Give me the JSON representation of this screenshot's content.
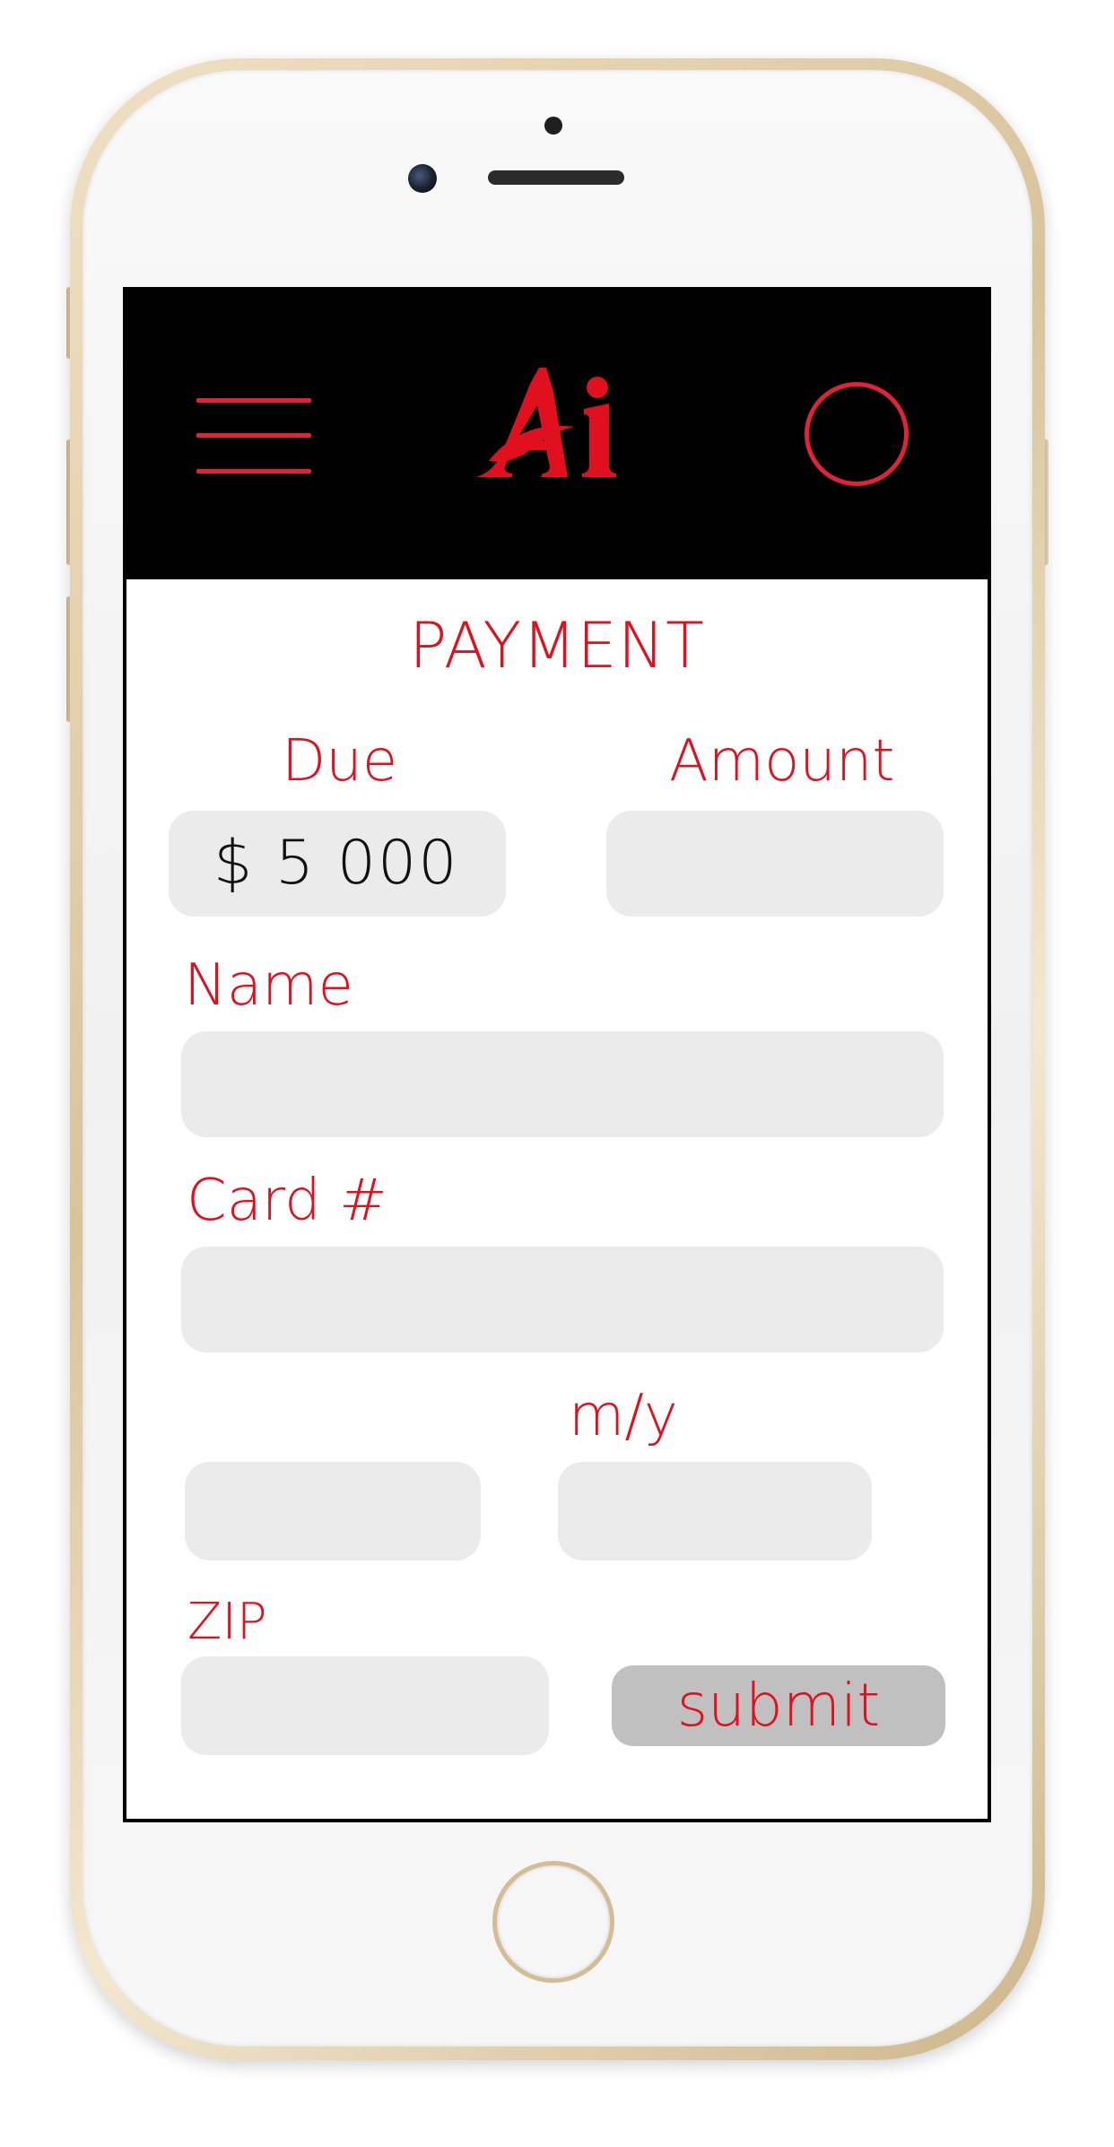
{
  "header": {
    "logo_text": "Ai",
    "logo_color": "#e0101f"
  },
  "page": {
    "title": "PAYMENT"
  },
  "form": {
    "due_label": "Due",
    "due_value": "$ 5 000",
    "amount_label": "Amount",
    "amount_value": "",
    "name_label": "Name",
    "name_value": "",
    "card_label": "Card #",
    "card_value": "",
    "card_extra_value": "",
    "expiry_label": "m/y",
    "expiry_value": "",
    "zip_label": "ZIP",
    "zip_value": "",
    "submit_label": "submit"
  },
  "icons": {
    "menu": "hamburger-menu-icon",
    "profile": "profile-circle-icon",
    "home": "home-button"
  },
  "colors": {
    "accent": "#e0101f",
    "header_bg": "#000000",
    "field_bg": "#ebebeb",
    "submit_bg": "#c0c0c0"
  }
}
